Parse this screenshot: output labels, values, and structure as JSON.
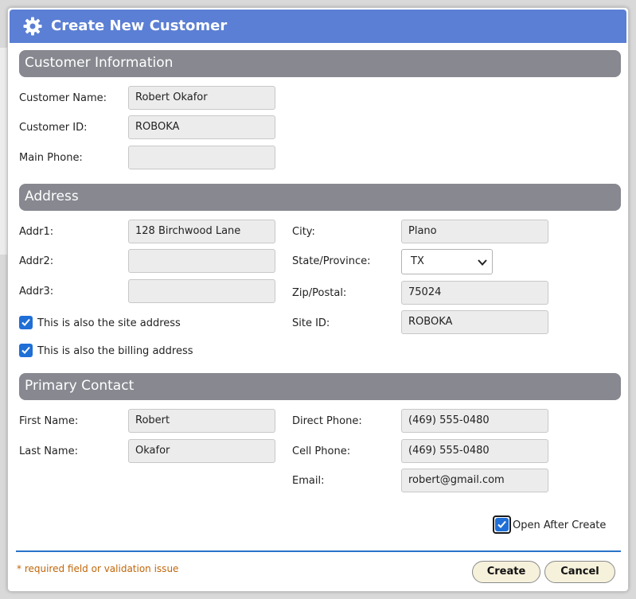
{
  "dialog": {
    "title": "Create New Customer",
    "title_icon": "gear-icon"
  },
  "sections": {
    "customer_info": "Customer Information",
    "address": "Address",
    "primary_contact": "Primary Contact"
  },
  "customer": {
    "name_label": "Customer Name:",
    "name_value": "Robert Okafor",
    "id_label": "Customer ID:",
    "id_value": "ROBOKA",
    "phone_label": "Main Phone:",
    "phone_value": ""
  },
  "address": {
    "addr1_label": "Addr1:",
    "addr1_value": "128 Birchwood Lane",
    "addr2_label": "Addr2:",
    "addr2_value": "",
    "addr3_label": "Addr3:",
    "addr3_value": "",
    "city_label": "City:",
    "city_value": "Plano",
    "state_label": "State/Province:",
    "state_value": "TX",
    "zip_label": "Zip/Postal:",
    "zip_value": "75024",
    "site_id_label": "Site ID:",
    "site_id_value": "ROBOKA",
    "site_checkbox_label": "This is also the site address",
    "site_checked": true,
    "billing_checkbox_label": "This is also the billing address",
    "billing_checked": true
  },
  "contact": {
    "first_label": "First Name:",
    "first_value": "Robert",
    "last_label": "Last Name:",
    "last_value": "Okafor",
    "direct_label": "Direct Phone:",
    "direct_value": "(469) 555-0480",
    "cell_label": "Cell Phone:",
    "cell_value": "(469) 555-0480",
    "email_label": "Email:",
    "email_value": "robert@gmail.com"
  },
  "options": {
    "open_after_label": "Open After Create",
    "open_after_checked": true
  },
  "footer": {
    "required_note": "* required field or validation issue",
    "create_label": "Create",
    "cancel_label": "Cancel"
  },
  "colors": {
    "titlebar": "#5b7fd4",
    "section_header": "#878890",
    "checkbox": "#1f6fd6",
    "divider": "#2a73c8",
    "required_text": "#c0660a",
    "button_bg": "#f6f1db"
  }
}
